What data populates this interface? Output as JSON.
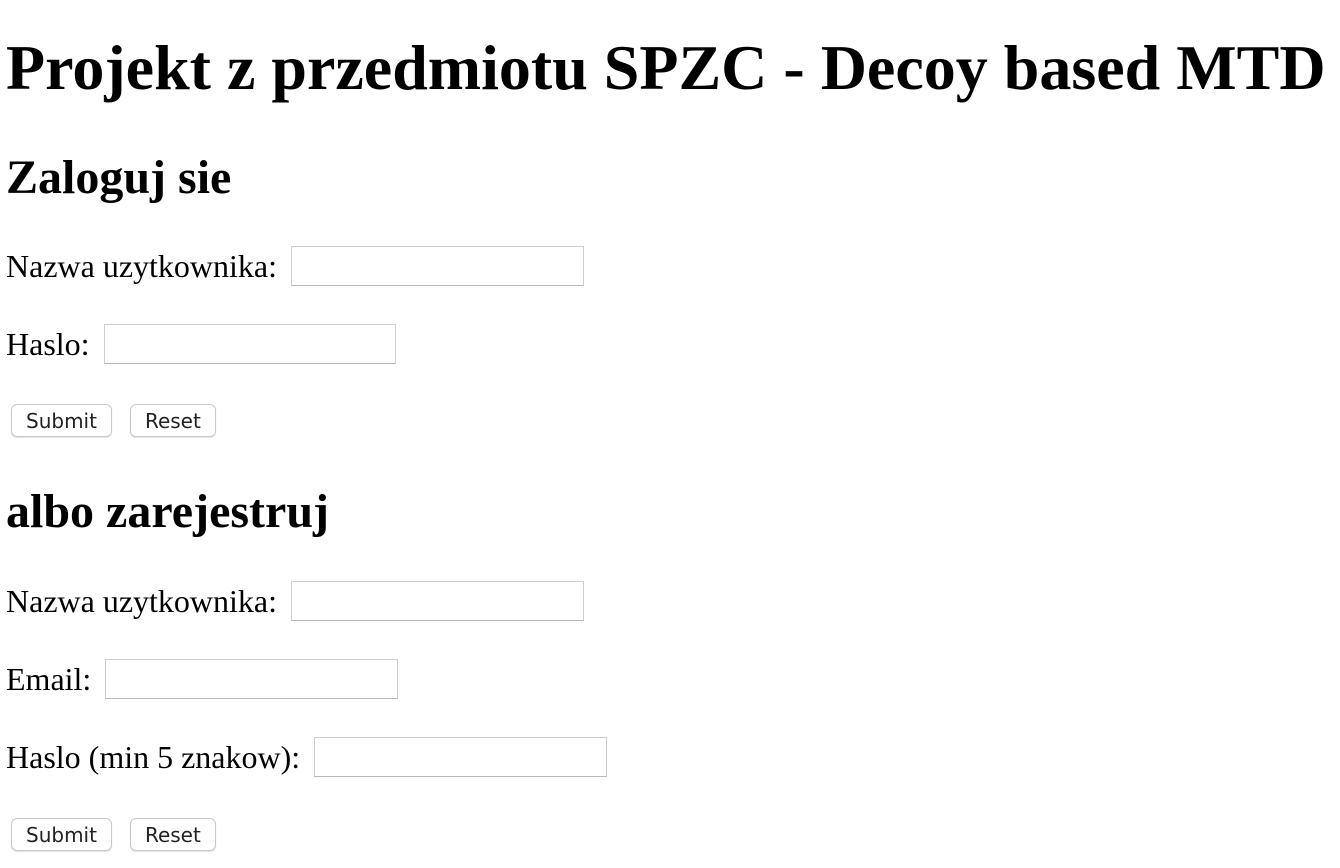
{
  "page": {
    "title": "Projekt z przedmiotu SPZC - Decoy based MTD"
  },
  "login": {
    "heading": "Zaloguj sie",
    "username_label": "Nazwa uzytkownika:",
    "username_value": "",
    "password_label": "Haslo:",
    "password_value": "",
    "submit_label": "Submit",
    "reset_label": "Reset"
  },
  "register": {
    "heading": "albo zarejestruj",
    "username_label": "Nazwa uzytkownika:",
    "username_value": "",
    "email_label": "Email:",
    "email_value": "",
    "password_label": "Haslo (min 5 znakow):",
    "password_value": "",
    "submit_label": "Submit",
    "reset_label": "Reset"
  }
}
